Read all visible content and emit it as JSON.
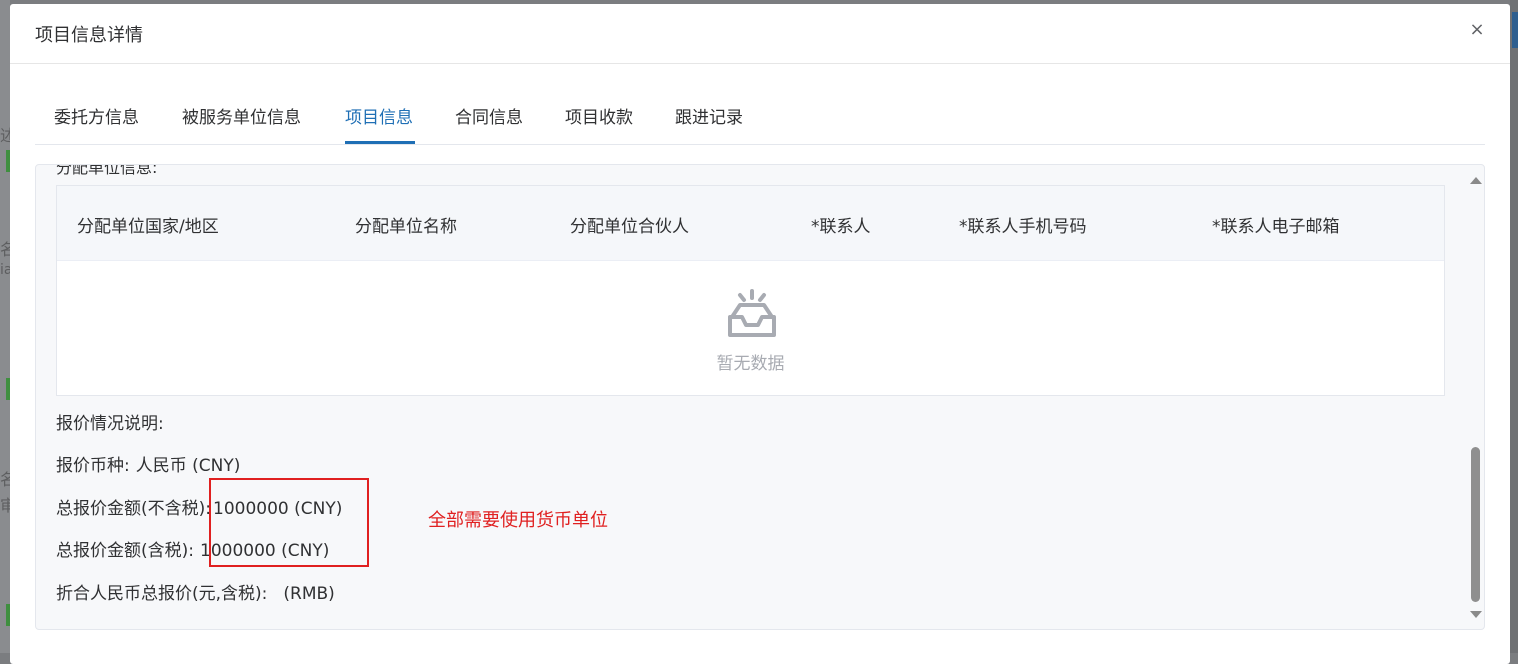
{
  "dialog": {
    "title": "项目信息详情",
    "close_label": "×"
  },
  "tabs": [
    {
      "label": "委托方信息",
      "active": false
    },
    {
      "label": "被服务单位信息",
      "active": false
    },
    {
      "label": "项目信息",
      "active": true
    },
    {
      "label": "合同信息",
      "active": false
    },
    {
      "label": "项目收款",
      "active": false
    },
    {
      "label": "跟进记录",
      "active": false
    }
  ],
  "section": {
    "cut_label": "分配单位信息:"
  },
  "table": {
    "columns": [
      "分配单位国家/地区",
      "分配单位名称",
      "分配单位合伙人",
      "*联系人",
      "*联系人手机号码",
      "*联系人电子邮箱"
    ],
    "empty_text": "暂无数据"
  },
  "quote": {
    "description_label": "报价情况说明:",
    "currency_label": "报价币种:",
    "currency_value": "人民币 (CNY)",
    "total_excl_tax_label": "总报价金额(不含税):",
    "total_excl_tax_value": "1000000 (CNY)",
    "total_incl_tax_label": "总报价金额(含税):",
    "total_incl_tax_value": "1000000 (CNY)",
    "rmb_total_label": "折合人民币总报价(元,含税):",
    "rmb_total_value": "(RMB)"
  },
  "annotation": {
    "text": "全部需要使用货币单位",
    "color": "#e02020"
  },
  "colors": {
    "accent": "#1f6fb5",
    "annotation_red": "#e02020"
  }
}
